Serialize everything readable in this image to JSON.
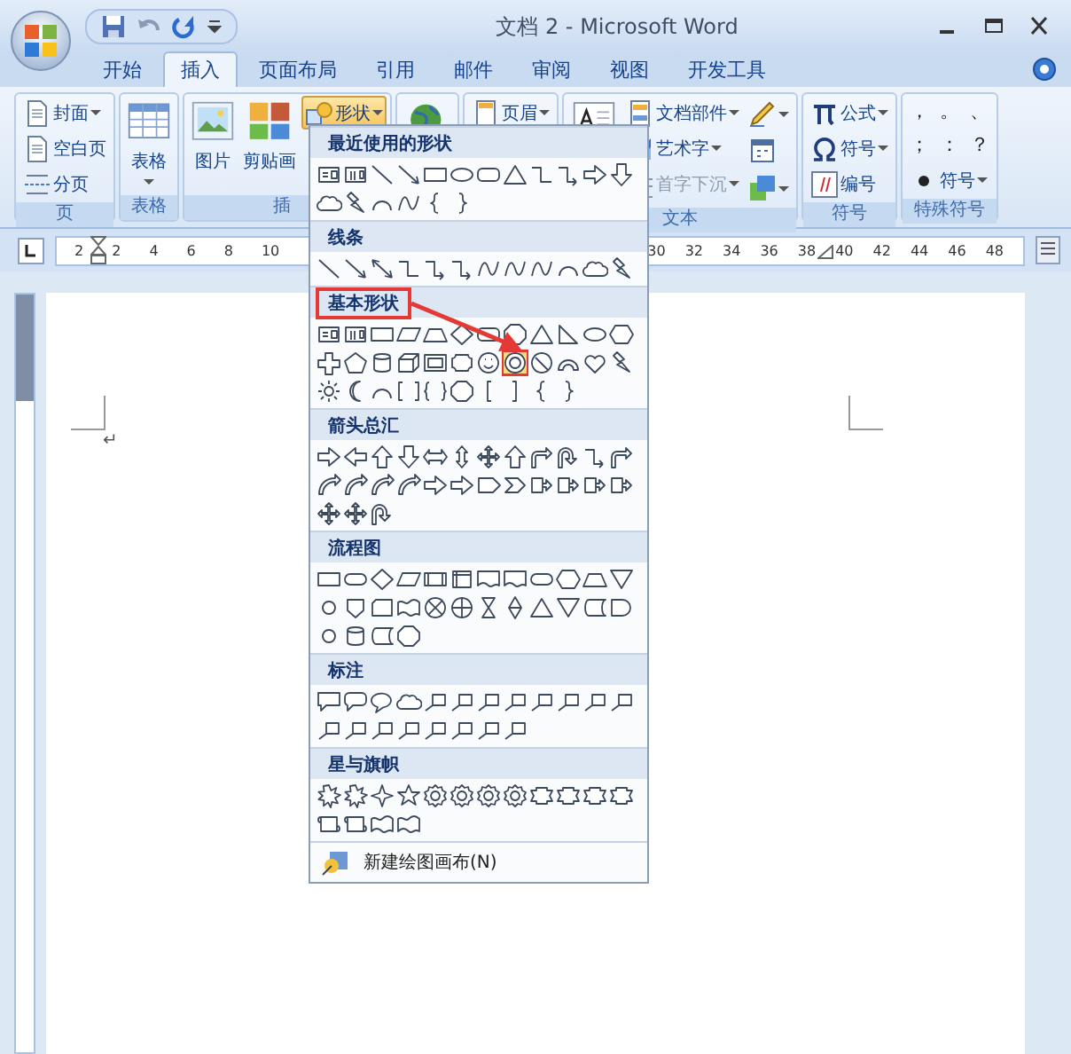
{
  "window": {
    "title": "文档 2 - Microsoft Word"
  },
  "tabs": [
    {
      "label": "开始",
      "selected": false
    },
    {
      "label": "插入",
      "selected": true
    },
    {
      "label": "页面布局",
      "selected": false
    },
    {
      "label": "引用",
      "selected": false
    },
    {
      "label": "邮件",
      "selected": false
    },
    {
      "label": "审阅",
      "selected": false
    },
    {
      "label": "视图",
      "selected": false
    },
    {
      "label": "开发工具",
      "selected": false
    }
  ],
  "ribbon": {
    "groups": [
      {
        "label": "页",
        "columns": [
          [
            {
              "kind": "small",
              "label": "封面",
              "dropdown": true,
              "pressed": false,
              "disabled": false
            },
            {
              "kind": "small",
              "label": "空白页",
              "dropdown": false,
              "pressed": false,
              "disabled": false
            },
            {
              "kind": "small",
              "label": "分页",
              "dropdown": false,
              "pressed": false,
              "disabled": false
            }
          ]
        ]
      },
      {
        "label": "表格",
        "columns": [
          [
            {
              "kind": "large",
              "label": "表格",
              "dropdown": true,
              "pressed": false,
              "disabled": false
            }
          ]
        ]
      },
      {
        "label": "插",
        "columns": [
          [
            {
              "kind": "large",
              "label": "图片",
              "dropdown": false,
              "pressed": false,
              "disabled": false
            }
          ],
          [
            {
              "kind": "large",
              "label": "剪贴画",
              "dropdown": false,
              "pressed": false,
              "disabled": false
            }
          ],
          [
            {
              "kind": "small",
              "label": "形状",
              "dropdown": true,
              "pressed": true,
              "disabled": false
            }
          ]
        ]
      },
      {
        "columns": [
          [
            {
              "kind": "icon",
              "dropdown": false,
              "pressed": false,
              "disabled": false
            }
          ]
        ]
      },
      {
        "columns": [
          [
            {
              "kind": "small",
              "label": "页眉",
              "dropdown": true,
              "pressed": false,
              "disabled": false
            }
          ]
        ]
      },
      {
        "label": "文本",
        "columns": [
          [
            {
              "kind": "icon",
              "dropdown": false,
              "pressed": false,
              "disabled": false
            }
          ],
          [
            {
              "kind": "small",
              "label": "文档部件",
              "dropdown": true,
              "pressed": false,
              "disabled": false
            },
            {
              "kind": "small",
              "label": "艺术字",
              "dropdown": true,
              "pressed": false,
              "disabled": false
            },
            {
              "kind": "small",
              "label": "首字下沉",
              "dropdown": true,
              "pressed": false,
              "disabled": true
            }
          ],
          [
            {
              "kind": "icon",
              "dropdown": true,
              "pressed": false,
              "disabled": false
            },
            {
              "kind": "icon",
              "dropdown": false,
              "pressed": false,
              "disabled": false
            },
            {
              "kind": "icon",
              "dropdown": true,
              "pressed": false,
              "disabled": false
            }
          ]
        ]
      },
      {
        "label": "符号",
        "columns": [
          [
            {
              "kind": "small",
              "label": "公式",
              "dropdown": true,
              "pressed": false,
              "disabled": false
            },
            {
              "kind": "small",
              "label": "符号",
              "dropdown": true,
              "pressed": false,
              "disabled": false
            },
            {
              "kind": "small",
              "label": "编号",
              "dropdown": false,
              "pressed": false,
              "disabled": false
            }
          ]
        ]
      },
      {
        "label": "特殊符号",
        "symbols": [
          "，",
          "。",
          "、",
          "；",
          "：",
          "？"
        ],
        "columns": [
          [
            {
              "kind": "small",
              "label": "符号",
              "dropdown": true,
              "pressed": false,
              "disabled": false
            }
          ]
        ]
      }
    ]
  },
  "shapes_menu": {
    "sections": [
      {
        "title": "最近使用的形状",
        "highlighted": false,
        "shapes": [
          {
            "kind": "textbox",
            "selected": false
          },
          {
            "kind": "vtextbox",
            "selected": false
          },
          {
            "kind": "line",
            "selected": false
          },
          {
            "kind": "arrowline",
            "selected": false
          },
          {
            "kind": "rect",
            "selected": false
          },
          {
            "kind": "oval",
            "selected": false
          },
          {
            "kind": "rounded",
            "selected": false
          },
          {
            "kind": "triangle",
            "selected": false
          },
          {
            "kind": "elbow",
            "selected": false
          },
          {
            "kind": "elbowarrow",
            "selected": false
          },
          {
            "kind": "rarrow",
            "selected": false
          },
          {
            "kind": "darrow",
            "selected": false
          },
          {
            "kind": "cloud",
            "selected": false
          },
          {
            "kind": "bolt",
            "selected": false
          },
          {
            "kind": "arc",
            "selected": false
          },
          {
            "kind": "curve",
            "selected": false
          },
          {
            "kind": "bracel",
            "selected": false
          },
          {
            "kind": "bracer",
            "selected": false
          }
        ]
      },
      {
        "title": "线条",
        "highlighted": false,
        "shapes": [
          {
            "kind": "line",
            "selected": false
          },
          {
            "kind": "arrowline",
            "selected": false
          },
          {
            "kind": "dblarrow",
            "selected": false
          },
          {
            "kind": "elbow",
            "selected": false
          },
          {
            "kind": "elbowarrow",
            "selected": false
          },
          {
            "kind": "elbowarrow",
            "selected": false
          },
          {
            "kind": "curve",
            "selected": false
          },
          {
            "kind": "curve",
            "selected": false
          },
          {
            "kind": "curve",
            "selected": false
          },
          {
            "kind": "arc",
            "selected": false
          },
          {
            "kind": "cloud",
            "selected": false
          },
          {
            "kind": "bolt",
            "selected": false
          }
        ]
      },
      {
        "title": "基本形状",
        "highlighted": true,
        "shapes": [
          {
            "kind": "textbox",
            "selected": false
          },
          {
            "kind": "vtextbox",
            "selected": false
          },
          {
            "kind": "rect",
            "selected": false
          },
          {
            "kind": "parallelogram",
            "selected": false
          },
          {
            "kind": "trapezoid",
            "selected": false
          },
          {
            "kind": "diamond",
            "selected": false
          },
          {
            "kind": "rounded",
            "selected": false
          },
          {
            "kind": "octagon",
            "selected": false
          },
          {
            "kind": "triangle",
            "selected": false
          },
          {
            "kind": "rtriangle",
            "selected": false
          },
          {
            "kind": "oval",
            "selected": false
          },
          {
            "kind": "hexagon",
            "selected": false
          },
          {
            "kind": "cross",
            "selected": false
          },
          {
            "kind": "pentagon",
            "selected": false
          },
          {
            "kind": "cylinder",
            "selected": false
          },
          {
            "kind": "cube",
            "selected": false
          },
          {
            "kind": "frame",
            "selected": false
          },
          {
            "kind": "plaque",
            "selected": false
          },
          {
            "kind": "smiley",
            "selected": false
          },
          {
            "kind": "donut",
            "selected": true
          },
          {
            "kind": "nosymbol",
            "selected": false
          },
          {
            "kind": "blockarc",
            "selected": false
          },
          {
            "kind": "heart",
            "selected": false
          },
          {
            "kind": "bolt",
            "selected": false
          },
          {
            "kind": "sun",
            "selected": false
          },
          {
            "kind": "moon",
            "selected": false
          },
          {
            "kind": "arc",
            "selected": false
          },
          {
            "kind": "bracketpair",
            "selected": false
          },
          {
            "kind": "bracepair",
            "selected": false
          },
          {
            "kind": "octagon",
            "selected": false
          },
          {
            "kind": "bracketl",
            "selected": false
          },
          {
            "kind": "bracketr",
            "selected": false
          },
          {
            "kind": "bracel",
            "selected": false
          },
          {
            "kind": "bracer",
            "selected": false
          }
        ]
      },
      {
        "title": "箭头总汇",
        "highlighted": false,
        "shapes": [
          {
            "kind": "rarrow",
            "selected": false
          },
          {
            "kind": "larrow",
            "selected": false
          },
          {
            "kind": "uarrow",
            "selected": false
          },
          {
            "kind": "darrow",
            "selected": false
          },
          {
            "kind": "lrarrow",
            "selected": false
          },
          {
            "kind": "udarrow",
            "selected": false
          },
          {
            "kind": "quad",
            "selected": false
          },
          {
            "kind": "uarrow",
            "selected": false
          },
          {
            "kind": "bent",
            "selected": false
          },
          {
            "kind": "uturn",
            "selected": false
          },
          {
            "kind": "elbowarrow",
            "selected": false
          },
          {
            "kind": "bent",
            "selected": false
          },
          {
            "kind": "curvedarrow",
            "selected": false
          },
          {
            "kind": "curvedarrow",
            "selected": false
          },
          {
            "kind": "curvedarrow",
            "selected": false
          },
          {
            "kind": "curvedarrow",
            "selected": false
          },
          {
            "kind": "rarrow",
            "selected": false
          },
          {
            "kind": "rarrow",
            "selected": false
          },
          {
            "kind": "pentarrow",
            "selected": false
          },
          {
            "kind": "chevron",
            "selected": false
          },
          {
            "kind": "arrowcallout",
            "selected": false
          },
          {
            "kind": "arrowcallout",
            "selected": false
          },
          {
            "kind": "arrowcallout",
            "selected": false
          },
          {
            "kind": "arrowcallout",
            "selected": false
          },
          {
            "kind": "quad",
            "selected": false
          },
          {
            "kind": "quad",
            "selected": false
          },
          {
            "kind": "uturn",
            "selected": false
          }
        ]
      },
      {
        "title": "流程图",
        "highlighted": false,
        "shapes": [
          {
            "kind": "rect",
            "selected": false
          },
          {
            "kind": "terminator",
            "selected": false
          },
          {
            "kind": "diamond",
            "selected": false
          },
          {
            "kind": "parallelogram",
            "selected": false
          },
          {
            "kind": "predefined",
            "selected": false
          },
          {
            "kind": "internal",
            "selected": false
          },
          {
            "kind": "document",
            "selected": false
          },
          {
            "kind": "document",
            "selected": false
          },
          {
            "kind": "terminator",
            "selected": false
          },
          {
            "kind": "hexagon",
            "selected": false
          },
          {
            "kind": "trapezoid",
            "selected": false
          },
          {
            "kind": "merge",
            "selected": false
          },
          {
            "kind": "circle",
            "selected": false
          },
          {
            "kind": "offpage",
            "selected": false
          },
          {
            "kind": "card",
            "selected": false
          },
          {
            "kind": "wave",
            "selected": false
          },
          {
            "kind": "sumjunction",
            "selected": false
          },
          {
            "kind": "or",
            "selected": false
          },
          {
            "kind": "collate",
            "selected": false
          },
          {
            "kind": "sort",
            "selected": false
          },
          {
            "kind": "triangle",
            "selected": false
          },
          {
            "kind": "merge",
            "selected": false
          },
          {
            "kind": "storeddata",
            "selected": false
          },
          {
            "kind": "delay",
            "selected": false
          },
          {
            "kind": "circle",
            "selected": false
          },
          {
            "kind": "cylinder",
            "selected": false
          },
          {
            "kind": "storeddata",
            "selected": false
          },
          {
            "kind": "octagon",
            "selected": false
          }
        ]
      },
      {
        "title": "标注",
        "highlighted": false,
        "shapes": [
          {
            "kind": "callout",
            "selected": false
          },
          {
            "kind": "roundcallout",
            "selected": false
          },
          {
            "kind": "ovalcallout",
            "selected": false
          },
          {
            "kind": "cloud",
            "selected": false
          },
          {
            "kind": "linecallout",
            "selected": false
          },
          {
            "kind": "linecallout",
            "selected": false
          },
          {
            "kind": "linecallout",
            "selected": false
          },
          {
            "kind": "linecallout",
            "selected": false
          },
          {
            "kind": "linecallout",
            "selected": false
          },
          {
            "kind": "linecallout",
            "selected": false
          },
          {
            "kind": "linecallout",
            "selected": false
          },
          {
            "kind": "linecallout",
            "selected": false
          },
          {
            "kind": "linecallout",
            "selected": false
          },
          {
            "kind": "linecallout",
            "selected": false
          },
          {
            "kind": "linecallout",
            "selected": false
          },
          {
            "kind": "linecallout",
            "selected": false
          },
          {
            "kind": "linecallout",
            "selected": false
          },
          {
            "kind": "linecallout",
            "selected": false
          },
          {
            "kind": "linecallout",
            "selected": false
          },
          {
            "kind": "linecallout",
            "selected": false
          }
        ]
      },
      {
        "title": "星与旗帜",
        "highlighted": false,
        "shapes": [
          {
            "kind": "explosion",
            "selected": false
          },
          {
            "kind": "explosion",
            "selected": false
          },
          {
            "kind": "star4",
            "selected": false
          },
          {
            "kind": "star5",
            "selected": false
          },
          {
            "kind": "seal",
            "selected": false
          },
          {
            "kind": "seal",
            "selected": false
          },
          {
            "kind": "seal",
            "selected": false
          },
          {
            "kind": "seal",
            "selected": false
          },
          {
            "kind": "ribbon",
            "selected": false
          },
          {
            "kind": "ribbon",
            "selected": false
          },
          {
            "kind": "ribbon",
            "selected": false
          },
          {
            "kind": "ribbon",
            "selected": false
          },
          {
            "kind": "scroll",
            "selected": false
          },
          {
            "kind": "scroll",
            "selected": false
          },
          {
            "kind": "wave",
            "selected": false
          },
          {
            "kind": "wave",
            "selected": false
          }
        ]
      }
    ],
    "footer": {
      "label": "新建绘图画布(N)"
    },
    "pointer_arrow": true
  },
  "ruler": {
    "left_numbers": [
      "2",
      "2",
      "4",
      "6",
      "8",
      "10"
    ],
    "right_numbers": [
      "30",
      "32",
      "34",
      "36",
      "38",
      "40",
      "42",
      "44",
      "46",
      "48"
    ]
  },
  "document": {
    "paragraph_mark": "↵"
  }
}
